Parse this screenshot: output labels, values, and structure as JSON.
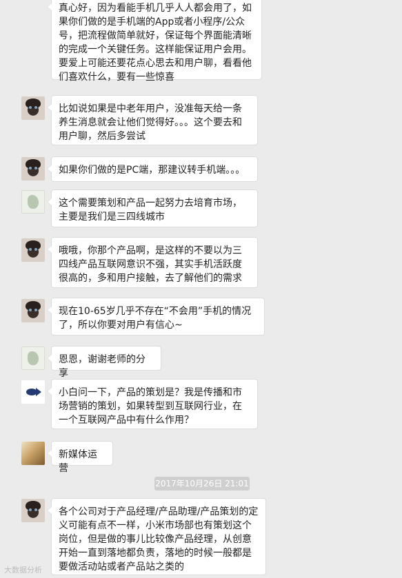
{
  "messages": [
    {
      "text": "真心好，因为看能手机几乎人人都会用了，如果你们做的是手机端的App或者小程序/公众号，把流程做简单就好，保证每个界面能清晰的完成一个关键任务。这样能保证用户会用。要爱上可能还要花点心思去和用户聊，看看他们喜欢什么，要有一些惊喜"
    },
    {
      "text": "比如说如果是中老年用户，没准每天给一条养生消息就会让他们觉得好。。。这个要去和用户聊，然后多尝试"
    },
    {
      "text": "如果你们做的是PC端，那建议转手机端。。。"
    },
    {
      "text": "这个需要策划和产品一起努力去培育市场，主要是我们是三四线城市"
    },
    {
      "text": "哦哦，你那个产品啊，是这样的不要以为三四线产品互联网意识不强，其实手机活跃度很高的，多和用户接触，去了解他们的需求"
    },
    {
      "text": "现在10-65岁几乎不存在“不会用”手机的情况了，所以你要对用户有信心~"
    },
    {
      "text": "恩恩，谢谢老师的分享"
    },
    {
      "text": "小白问一下，产品的策划是？我是传播和市场营销的策划，如果转型到互联网行业，在一个互联网产品中有什么作用？"
    },
    {
      "text": "新媒体运营"
    },
    {
      "text": "各个公司对于产品经理/产品助理/产品策划的定义可能有点不一样，小米市场部也有策划这个岗位，但是做的事儿比较像产品经理，从创意开始一直到落地都负责，落地的时候一般都是要做活动站或者产品站之类的"
    }
  ],
  "timestamp": "2017年10月26日 21:01",
  "watermark": "大数据分析"
}
